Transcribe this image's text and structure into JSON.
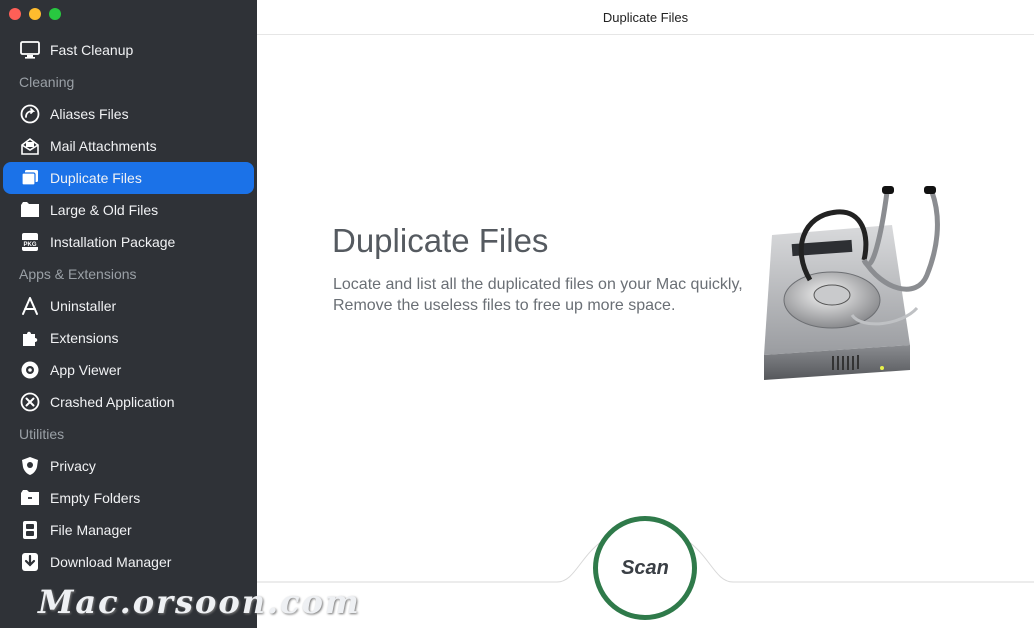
{
  "window": {
    "title": "Duplicate Files"
  },
  "sidebar": {
    "fast_cleanup": "Fast Cleanup",
    "sections": {
      "cleaning": "Cleaning",
      "apps": "Apps & Extensions",
      "utilities": "Utilities"
    },
    "cleaning_items": [
      {
        "label": "Aliases Files",
        "icon": "alias-icon"
      },
      {
        "label": "Mail Attachments",
        "icon": "mail-attachment-icon"
      },
      {
        "label": "Duplicate Files",
        "icon": "duplicate-files-icon",
        "active": true
      },
      {
        "label": "Large & Old Files",
        "icon": "folder-icon"
      },
      {
        "label": "Installation Package",
        "icon": "pkg-icon"
      }
    ],
    "apps_items": [
      {
        "label": "Uninstaller",
        "icon": "app-store-icon"
      },
      {
        "label": "Extensions",
        "icon": "puzzle-icon"
      },
      {
        "label": "App Viewer",
        "icon": "app-viewer-icon"
      },
      {
        "label": "Crashed Application",
        "icon": "crash-icon"
      }
    ],
    "utilities_items": [
      {
        "label": "Privacy",
        "icon": "shield-icon"
      },
      {
        "label": "Empty Folders",
        "icon": "empty-folder-icon"
      },
      {
        "label": "File Manager",
        "icon": "file-manager-icon"
      },
      {
        "label": "Download Manager",
        "icon": "download-icon"
      }
    ]
  },
  "main": {
    "heading": "Duplicate Files",
    "description": "Locate and list all the duplicated files on your Mac quickly, Remove the useless files to free up more space.",
    "scan_label": "Scan"
  },
  "watermark": "Mac.orsoon.com",
  "colors": {
    "sidebar_bg": "#2f3237",
    "active": "#1b72e8",
    "scan_ring": "#2f7a4a"
  }
}
